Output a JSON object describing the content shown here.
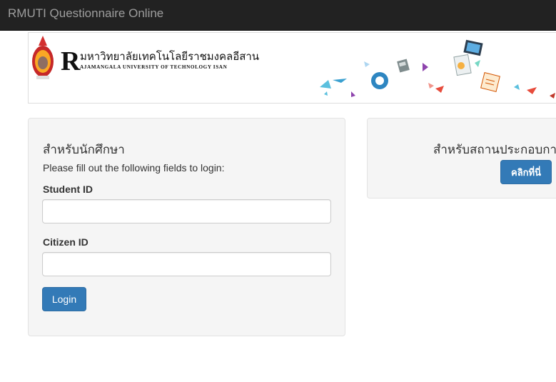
{
  "navbar": {
    "brand": "RMUTI Questionnaire Online"
  },
  "banner": {
    "logo_letter": "R",
    "university_name_th": "มหาวิทยาลัยเทคโนโลยีราชมงคลอีสาน",
    "university_name_en": "AJAMANGALA UNIVERSITY OF TECHNOLOGY ISAN"
  },
  "student_panel": {
    "title": "สำหรับนักศึกษา",
    "hint": "Please fill out the following fields to login:",
    "student_id_label": "Student ID",
    "student_id_value": "",
    "citizen_id_label": "Citizen ID",
    "citizen_id_value": "",
    "login_button": "Login"
  },
  "employer_panel": {
    "title": "สำหรับสถานประกอบกา",
    "button": "คลิกที่นี่"
  },
  "colors": {
    "navbar_bg": "#222222",
    "brand_text": "#9d9d9d",
    "primary_button": "#337ab7",
    "panel_bg": "#f5f5f5"
  }
}
